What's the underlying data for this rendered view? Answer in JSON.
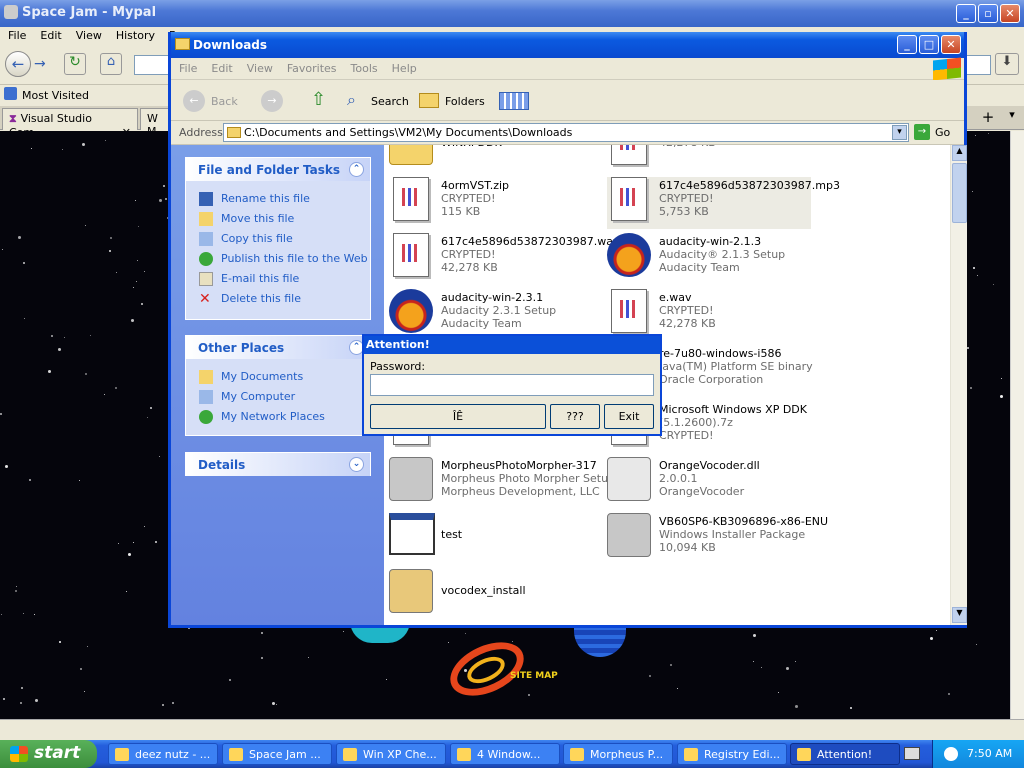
{
  "browser": {
    "title": "Space Jam - Mypal",
    "menu": [
      "File",
      "Edit",
      "View",
      "History",
      "B"
    ],
    "bookmark": "Most Visited",
    "tabs": [
      "Visual Studio Com...",
      "W M"
    ]
  },
  "explorer": {
    "title": "Downloads",
    "menu": [
      "File",
      "Edit",
      "View",
      "Favorites",
      "Tools",
      "Help"
    ],
    "toolbar": {
      "back": "Back",
      "search": "Search",
      "folders": "Folders"
    },
    "address_label": "Address",
    "address": "C:\\Documents and Settings\\VM2\\My Documents\\Downloads",
    "go": "Go",
    "tasks_title": "File and Folder Tasks",
    "tasks": [
      "Rename this file",
      "Move this file",
      "Copy this file",
      "Publish this file to the Web",
      "E-mail this file",
      "Delete this file"
    ],
    "places_title": "Other Places",
    "places": [
      "My Documents",
      "My Computer",
      "My Network Places"
    ],
    "details_title": "Details",
    "files": [
      {
        "name": "WINXPDDK",
        "line2": "",
        "line3": "",
        "icon": "folder-icon"
      },
      {
        "name": "",
        "line2": "CRYPTED!",
        "line3": "42,278 KB",
        "icon": "document-icon"
      },
      {
        "name": "4ormVST.zip",
        "line2": "CRYPTED!",
        "line3": "115 KB",
        "icon": "document-icon"
      },
      {
        "name": "617c4e5896d53872303987.mp3",
        "line2": "CRYPTED!",
        "line3": "5,753 KB",
        "icon": "document-icon"
      },
      {
        "name": "617c4e5896d53872303987.wav",
        "line2": "CRYPTED!",
        "line3": "42,278 KB",
        "icon": "document-icon"
      },
      {
        "name": "audacity-win-2.1.3",
        "line2": "Audacity® 2.1.3 Setup",
        "line3": "Audacity Team",
        "icon": "audacity-icon"
      },
      {
        "name": "audacity-win-2.3.1",
        "line2": "Audacity 2.3.1 Setup",
        "line3": "Audacity Team",
        "icon": "audacity-icon"
      },
      {
        "name": "e.wav",
        "line2": "CRYPTED!",
        "line3": "42,278 KB",
        "icon": "document-icon"
      },
      {
        "name": "re-7u80-windows-i586",
        "line2": "Java(TM) Platform SE binary",
        "line3": "Oracle Corporation",
        "icon": "java-icon"
      },
      {
        "name": "Microsoft Windows XP DDK",
        "line2": "(5.1.2600).7z",
        "line3": "CRYPTED!",
        "icon": "document-icon"
      },
      {
        "name": "",
        "line2": "",
        "line3": "CRYPTED!",
        "icon": "document-icon"
      },
      {
        "name": "MorpheusPhotoMorpher-317",
        "line2": "Morpheus Photo Morpher Setup",
        "line3": "Morpheus Development, LLC",
        "icon": "installer-icon"
      },
      {
        "name": "OrangeVocoder.dll",
        "line2": "2.0.0.1",
        "line3": "OrangeVocoder",
        "icon": "dll-icon"
      },
      {
        "name": "test",
        "line2": "",
        "line3": "",
        "icon": "window-icon"
      },
      {
        "name": "VB60SP6-KB3096896-x86-ENU",
        "line2": "Windows Installer Package",
        "line3": "10,094 KB",
        "icon": "installer-icon"
      },
      {
        "name": "vocodex_install",
        "line2": "",
        "line3": "",
        "icon": "nsis-icon"
      }
    ]
  },
  "dialog": {
    "title": "Attention!",
    "label": "Password:",
    "buttons": [
      "ÎÊ",
      "???",
      "Exit"
    ]
  },
  "desktop": {
    "site_map": "SITE MAP"
  },
  "taskbar": {
    "start": "start",
    "tasks": [
      "deez nutz - ...",
      "Space Jam ...",
      "Win XP Che...",
      "4 Window...",
      "Morpheus P...",
      "Registry Edi...",
      "Attention!"
    ],
    "clock": "7:50 AM"
  },
  "colors": {
    "xp_blue": "#0a46d8",
    "link": "#215dc6",
    "desktop_bg": "#05050c"
  }
}
